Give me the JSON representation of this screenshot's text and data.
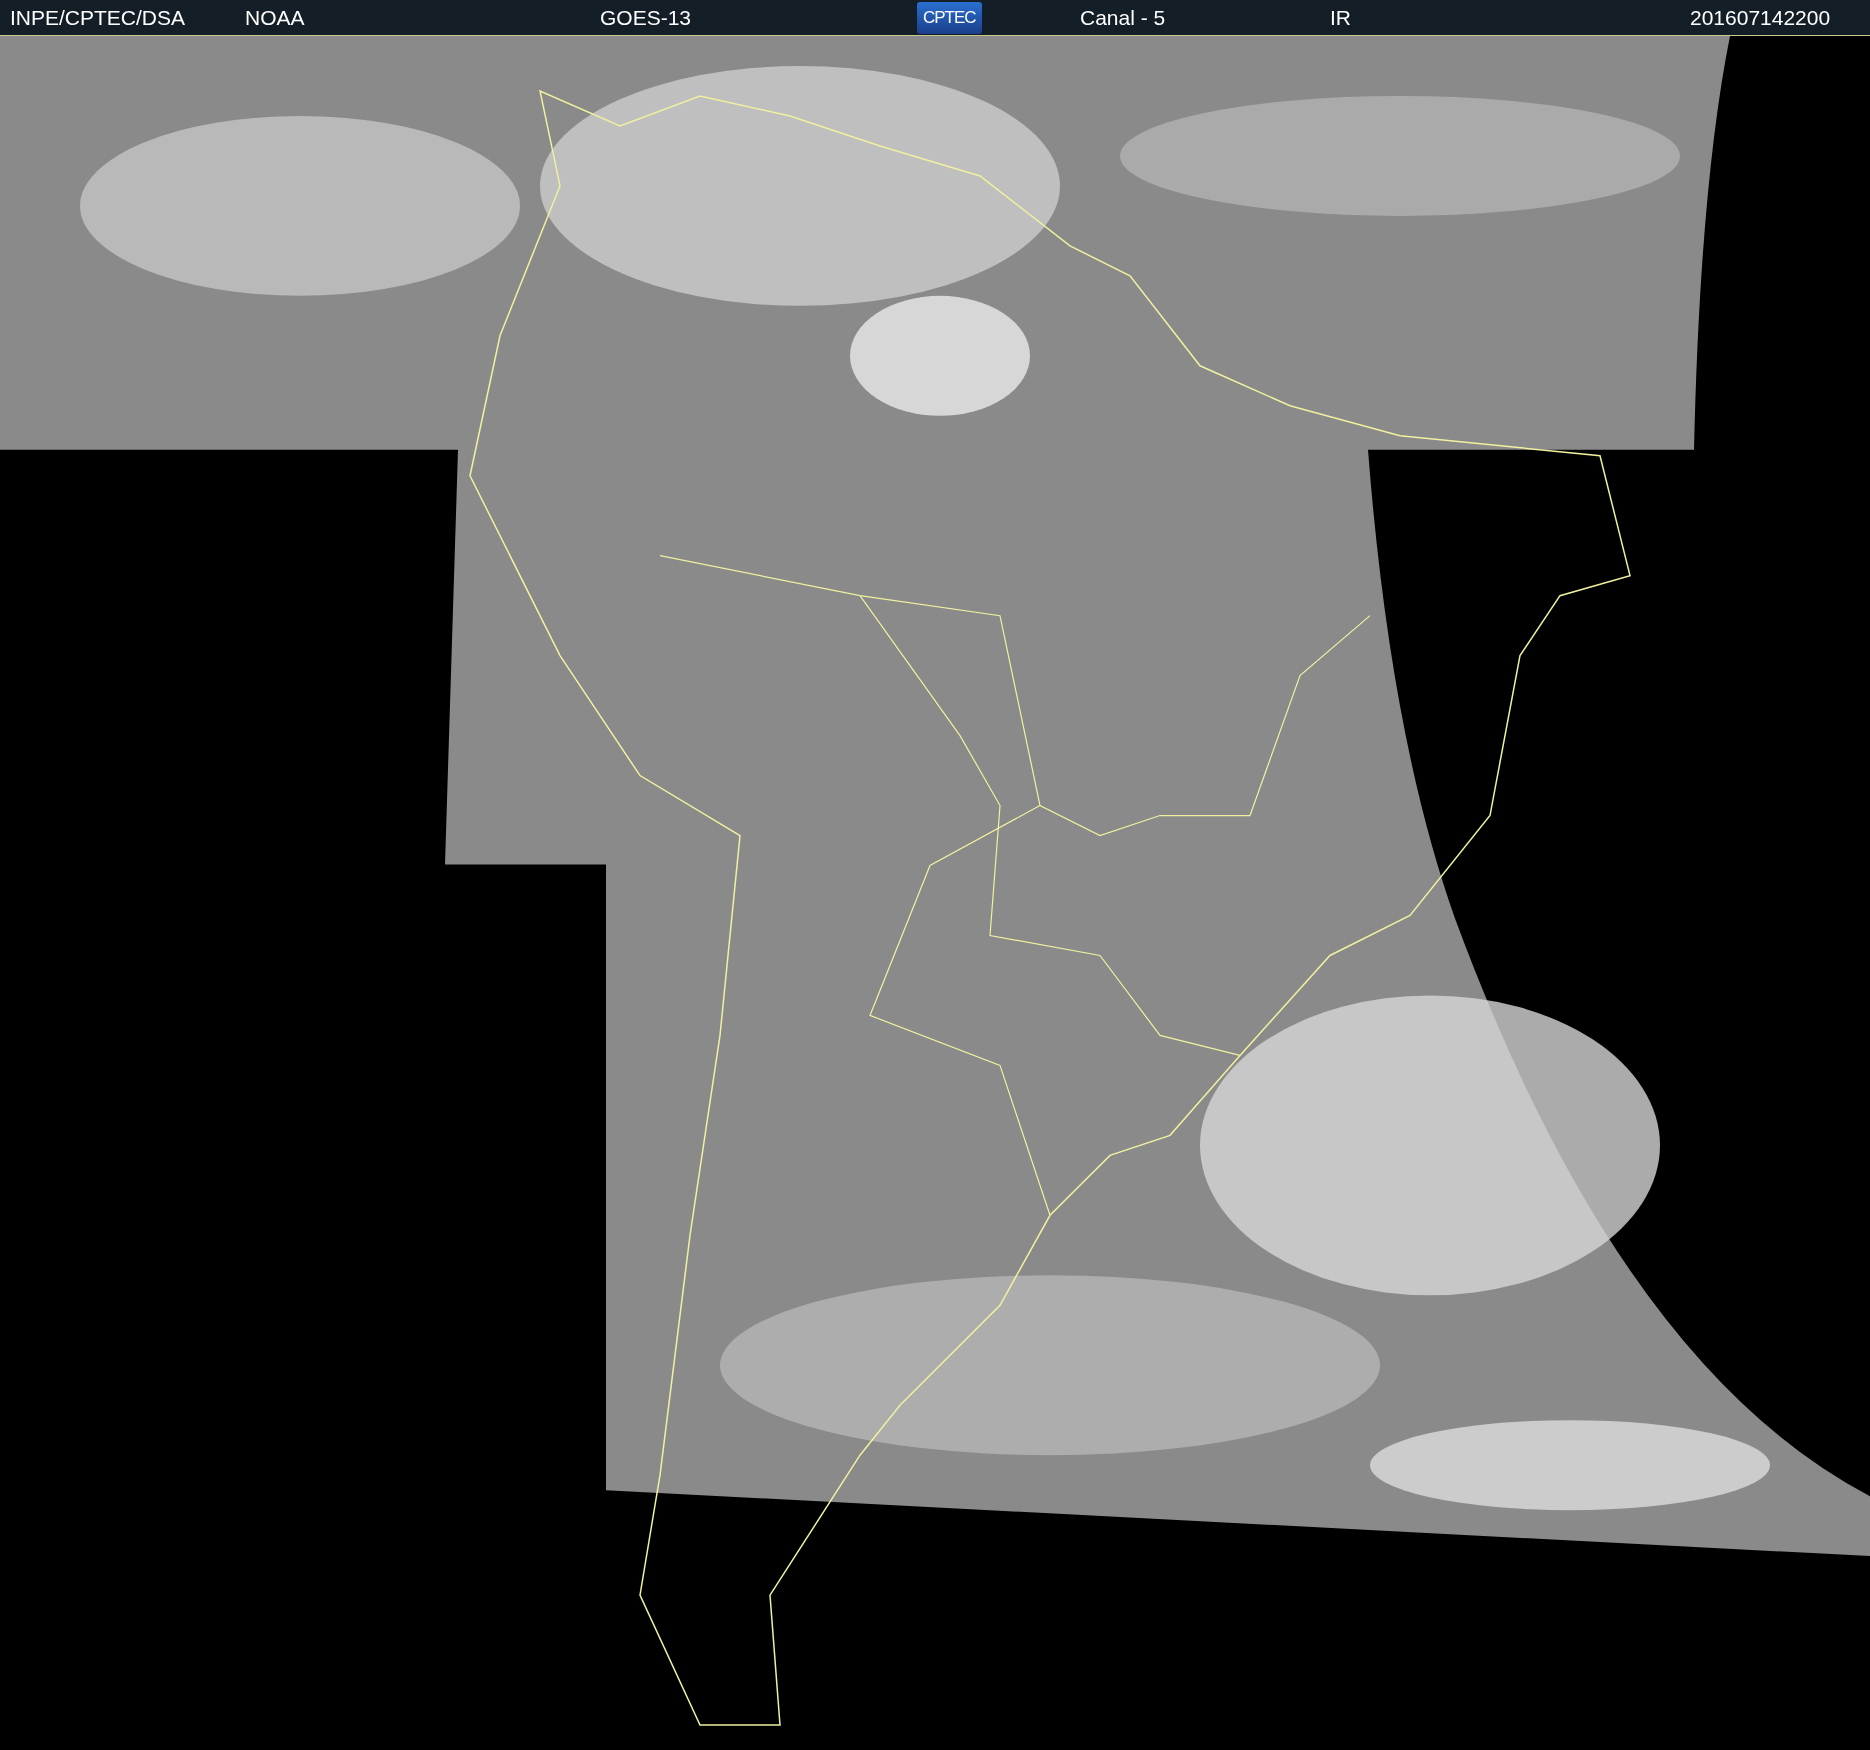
{
  "header": {
    "agency": "INPE/CPTEC/DSA",
    "source": "NOAA",
    "satellite": "GOES-13",
    "logo": "CPTEC",
    "channel": "Canal - 5",
    "band": "IR",
    "timestamp": "201607142200"
  }
}
